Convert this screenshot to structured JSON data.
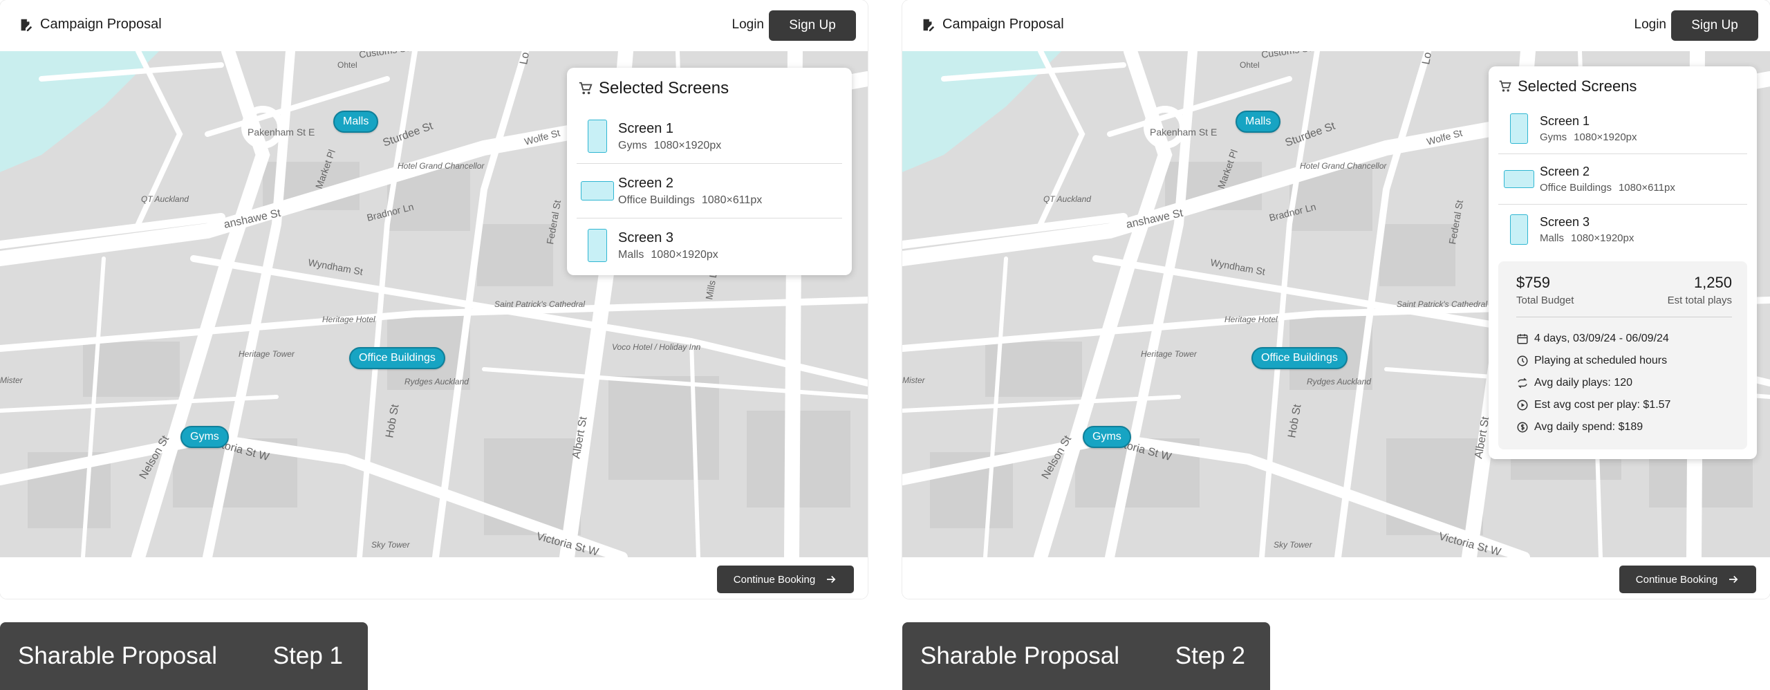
{
  "app": {
    "brand": "Campaign Proposal",
    "login": "Login",
    "signup": "Sign Up",
    "continue": "Continue Booking"
  },
  "accent": "#17a4c3",
  "map_labels": {
    "customs": "Customs St",
    "ohtel": "Ohtel",
    "pakenham": "Pakenham St E",
    "sturdee": "Sturdee St",
    "wolfe": "Wolfe St",
    "hotel_grand": "Hotel Grand Chancellor",
    "qt": "QT Auckland",
    "bradnor": "Bradnor Ln",
    "anshawe": "anshawe St",
    "federal": "Federal St",
    "wyndham": "Wyndham St",
    "heritage_hotel": "Heritage Hotel",
    "saint_patricks": "Saint Patrick's Cathedral",
    "heritage_tower": "Heritage Tower",
    "voco": "Voco Hotel / Holiday Inn",
    "rydges": "Rydges Auckland",
    "nelson": "Nelson St",
    "victoria_w": "ctoria St W",
    "albert": "Albert St",
    "sky_tower": "Sky Tower",
    "victoria_w2": "Victoria St W",
    "market": "Market Pl",
    "mills": "Mills Ln",
    "hob": "Hob St",
    "mister": "Mister",
    "lo": "Lo"
  },
  "pins": {
    "malls": "Malls",
    "office": "Office Buildings",
    "gyms": "Gyms"
  },
  "cart": {
    "title": "Selected Screens",
    "screens": [
      {
        "name": "Screen 1",
        "category": "Gyms",
        "size": "1080×1920px",
        "orientation": "portrait"
      },
      {
        "name": "Screen 2",
        "category": "Office Buildings",
        "size": "1080×611px",
        "orientation": "landscape"
      },
      {
        "name": "Screen 3",
        "category": "Malls",
        "size": "1080×1920px",
        "orientation": "portrait"
      }
    ]
  },
  "summary": {
    "budget": "$759",
    "budget_label": "Total Budget",
    "plays": "1,250",
    "plays_label": "Est total plays",
    "details": [
      {
        "icon": "calendar-icon",
        "text": "4 days, 03/09/24 - 06/09/24"
      },
      {
        "icon": "clock-icon",
        "text": "Playing at scheduled hours"
      },
      {
        "icon": "repeat-icon",
        "text": "Avg daily plays: 120"
      },
      {
        "icon": "play-icon",
        "text": "Est avg cost per play: $1.57"
      },
      {
        "icon": "dollar-icon",
        "text": "Avg daily spend: $189"
      }
    ]
  },
  "captions": [
    {
      "title": "Sharable Proposal",
      "step": "Step 1"
    },
    {
      "title": "Sharable Proposal",
      "step": "Step 2"
    }
  ]
}
